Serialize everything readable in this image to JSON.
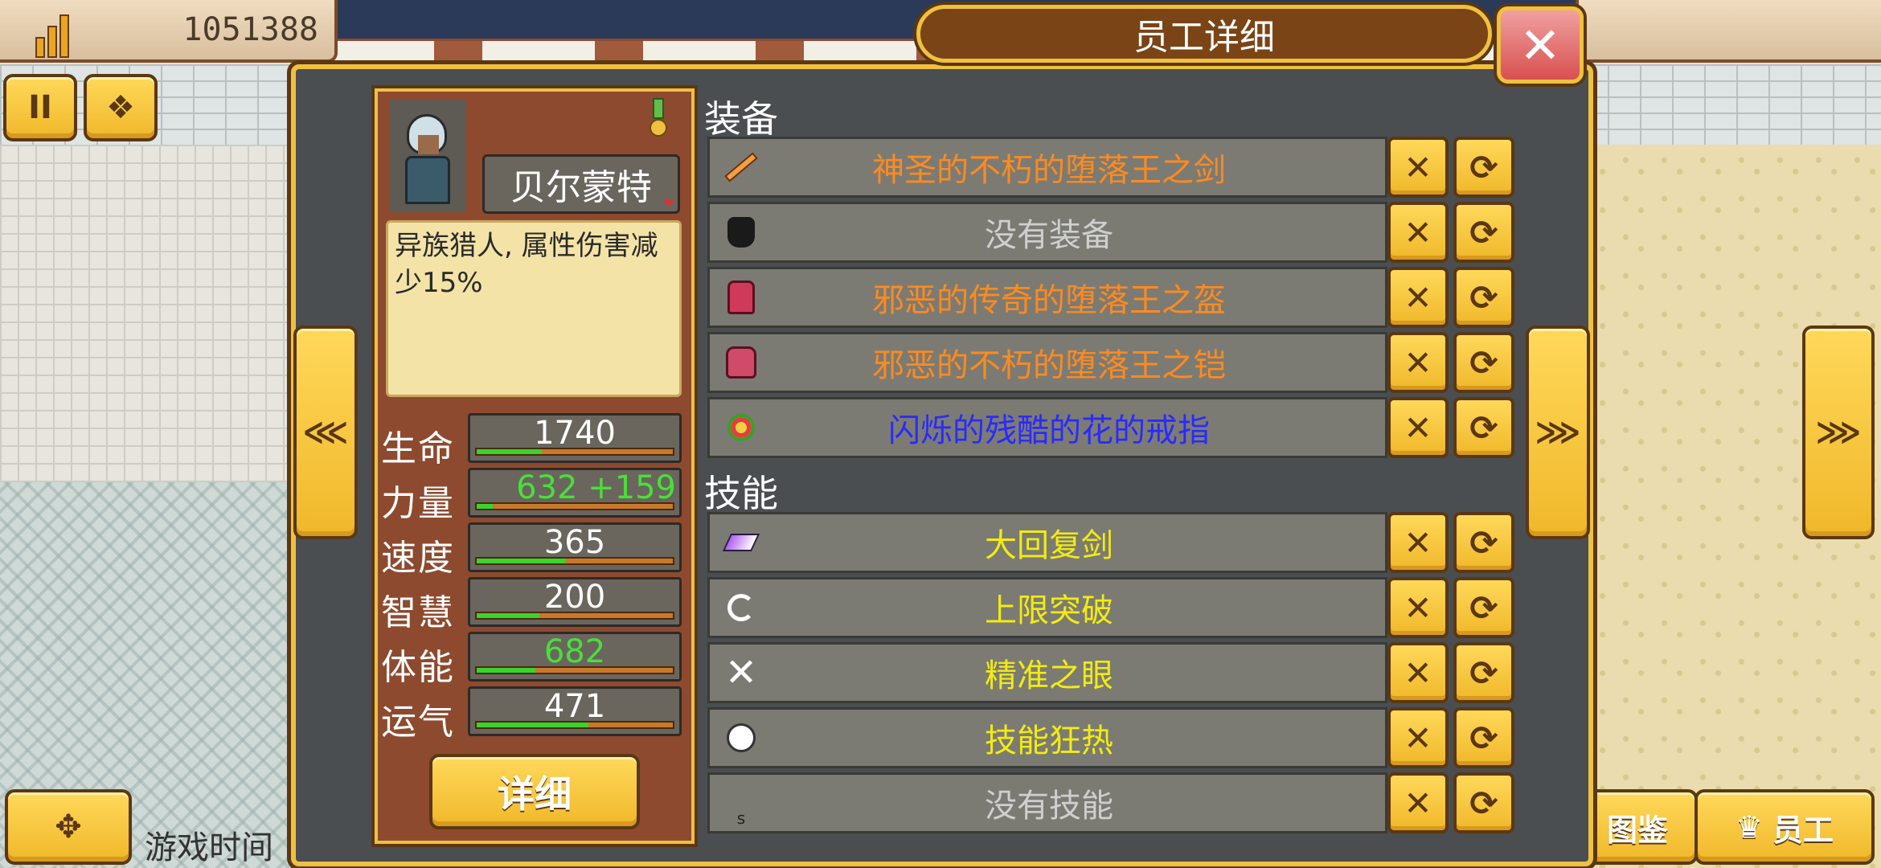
{
  "hud": {
    "money": "1051388",
    "game_time_label": "游戏时间",
    "pause_label": "II",
    "atlas_label": "图鉴",
    "staff_label": "员工"
  },
  "dialog": {
    "title": "员工详细",
    "close_label": "✕",
    "nav_left": "⋘",
    "nav_right": "⋙"
  },
  "character": {
    "name": "贝尔蒙特",
    "description": "异族猎人, 属性伤害减少15%",
    "detail_button": "详细",
    "stats": [
      {
        "label": "生命",
        "value": "1740",
        "fill": 0.33,
        "style": "normal"
      },
      {
        "label": "力量",
        "value": "632 +159",
        "fill": 0.08,
        "style": "green-right"
      },
      {
        "label": "速度",
        "value": "365",
        "fill": 0.45,
        "style": "normal"
      },
      {
        "label": "智慧",
        "value": "200",
        "fill": 0.32,
        "style": "normal"
      },
      {
        "label": "体能",
        "value": "682",
        "fill": 0.3,
        "style": "green"
      },
      {
        "label": "运气",
        "value": "471",
        "fill": 0.57,
        "style": "normal"
      }
    ]
  },
  "equipment": {
    "title": "装备",
    "items": [
      {
        "name": "神圣的不朽的堕落王之剑",
        "color": "#ff8a1e",
        "icon": "sword-icon"
      },
      {
        "name": "没有装备",
        "color": "#cfcfcf",
        "icon": "glove-icon"
      },
      {
        "name": "邪恶的传奇的堕落王之盔",
        "color": "#ff8a1e",
        "icon": "helmet-icon"
      },
      {
        "name": "邪恶的不朽的堕落王之铠",
        "color": "#ff8a1e",
        "icon": "armor-icon"
      },
      {
        "name": "闪烁的残酷的花的戒指",
        "color": "#2a2aff",
        "icon": "ring-icon"
      }
    ]
  },
  "skills": {
    "title": "技能",
    "items": [
      {
        "name": "大回复剑",
        "color": "#f2ec10",
        "icon": "skill-sword-icon"
      },
      {
        "name": "上限突破",
        "color": "#f2ec10",
        "icon": "chain-icon"
      },
      {
        "name": "精准之眼",
        "color": "#f2ec10",
        "icon": "crossed-swords-icon"
      },
      {
        "name": "技能狂热",
        "color": "#f2ec10",
        "icon": "globe-icon"
      },
      {
        "name": "没有技能",
        "color": "#cfcfcf",
        "icon": "empty-slot-icon"
      }
    ]
  },
  "slot_buttons": {
    "unequip": "✕",
    "swap": "⟳"
  }
}
